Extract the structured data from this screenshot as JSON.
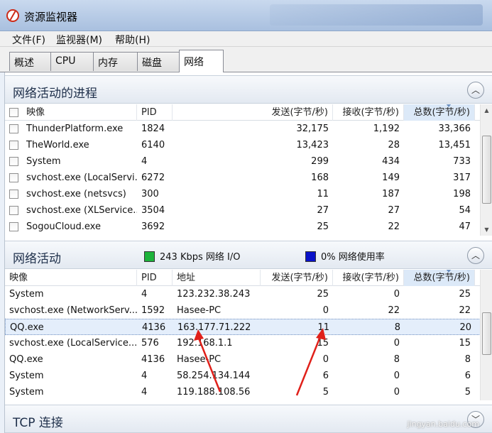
{
  "window": {
    "title": "资源监视器"
  },
  "menu": [
    "文件(F)",
    "监视器(M)",
    "帮助(H)"
  ],
  "tabs": [
    "概述",
    "CPU",
    "内存",
    "磁盘",
    "网络"
  ],
  "active_tab": "网络",
  "processes_section": {
    "title": "网络活动的进程",
    "columns": [
      "映像",
      "PID",
      "发送(字节/秒)",
      "接收(字节/秒)",
      "总数(字节/秒)"
    ],
    "rows": [
      {
        "name": "ThunderPlatform.exe",
        "pid": "1824",
        "send": "32,175",
        "recv": "1,192",
        "total": "33,366"
      },
      {
        "name": "TheWorld.exe",
        "pid": "6140",
        "send": "13,423",
        "recv": "28",
        "total": "13,451"
      },
      {
        "name": "System",
        "pid": "4",
        "send": "299",
        "recv": "434",
        "total": "733"
      },
      {
        "name": "svchost.exe (LocalServi...",
        "pid": "6272",
        "send": "168",
        "recv": "149",
        "total": "317"
      },
      {
        "name": "svchost.exe (netsvcs)",
        "pid": "300",
        "send": "11",
        "recv": "187",
        "total": "198"
      },
      {
        "name": "svchost.exe (XLService...",
        "pid": "3504",
        "send": "27",
        "recv": "27",
        "total": "54"
      },
      {
        "name": "SogouCloud.exe",
        "pid": "3692",
        "send": "25",
        "recv": "22",
        "total": "47"
      }
    ]
  },
  "activity_section": {
    "title": "网络活动",
    "io_text": "243 Kbps 网络 I/O",
    "usage_text": "0% 网络使用率",
    "io_color": "#1db33b",
    "usage_color": "#0a12c8",
    "columns": [
      "映像",
      "PID",
      "地址",
      "发送(字节/秒)",
      "接收(字节/秒)",
      "总数(字节/秒)"
    ],
    "rows": [
      {
        "name": "System",
        "pid": "4",
        "addr": "123.232.38.243",
        "send": "25",
        "recv": "0",
        "total": "25"
      },
      {
        "name": "svchost.exe (NetworkServ...",
        "pid": "1592",
        "addr": "Hasee-PC",
        "send": "0",
        "recv": "22",
        "total": "22"
      },
      {
        "name": "QQ.exe",
        "pid": "4136",
        "addr": "163.177.71.222",
        "send": "11",
        "recv": "8",
        "total": "20"
      },
      {
        "name": "svchost.exe (LocalService...",
        "pid": "576",
        "addr": "192.168.1.1",
        "send": "15",
        "recv": "0",
        "total": "15"
      },
      {
        "name": "QQ.exe",
        "pid": "4136",
        "addr": "Hasee-PC",
        "send": "0",
        "recv": "8",
        "total": "8"
      },
      {
        "name": "System",
        "pid": "4",
        "addr": "58.254.134.144",
        "send": "6",
        "recv": "0",
        "total": "6"
      },
      {
        "name": "System",
        "pid": "4",
        "addr": "119.188.108.56",
        "send": "5",
        "recv": "0",
        "total": "5"
      }
    ],
    "selected_row": 2
  },
  "tcp_section": {
    "title": "TCP 连接"
  },
  "watermark": "jingyan.baidu.com"
}
